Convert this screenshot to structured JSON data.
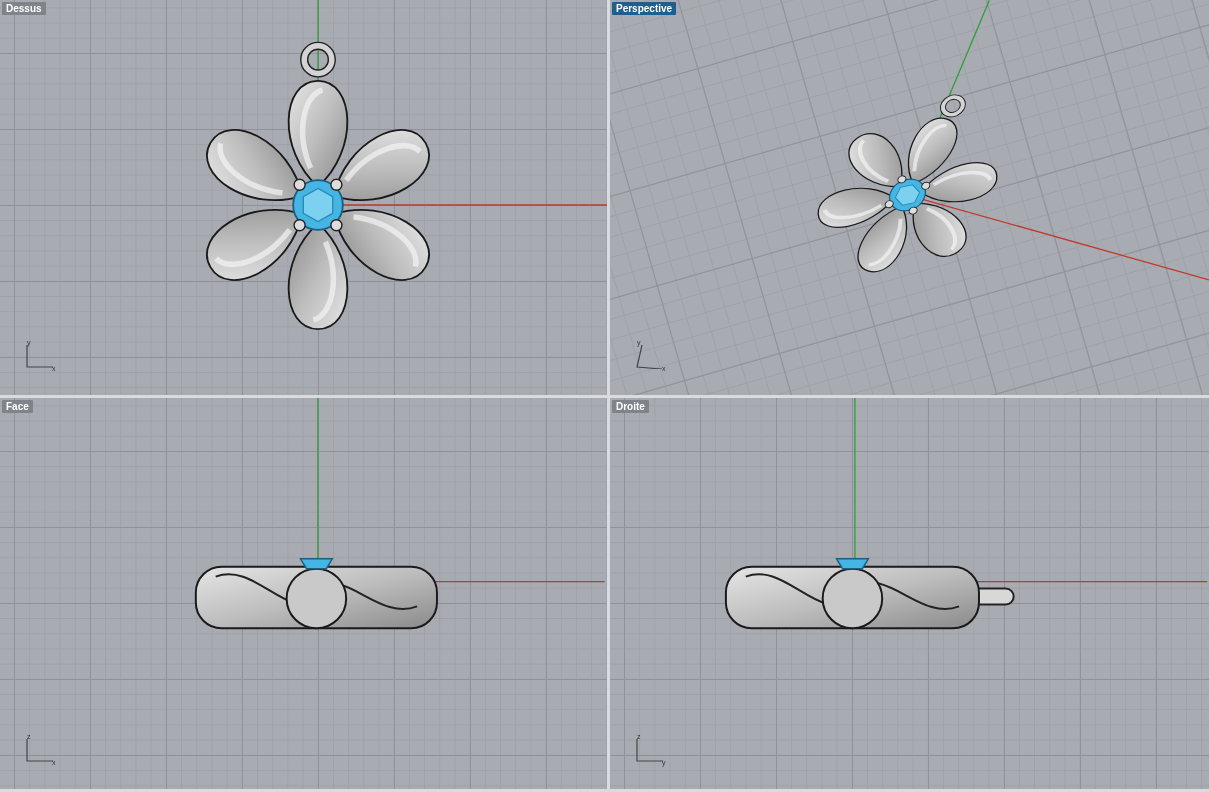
{
  "viewports": [
    {
      "label": "Dessus",
      "selected": false,
      "kind": "top",
      "axes": [
        "y",
        "x"
      ]
    },
    {
      "label": "Perspective",
      "selected": true,
      "kind": "perspective",
      "axes": [
        "y",
        "x"
      ]
    },
    {
      "label": "Face",
      "selected": false,
      "kind": "front",
      "axes": [
        "z",
        "x"
      ]
    },
    {
      "label": "Droite",
      "selected": false,
      "kind": "right",
      "axes": [
        "z",
        "y"
      ]
    }
  ]
}
